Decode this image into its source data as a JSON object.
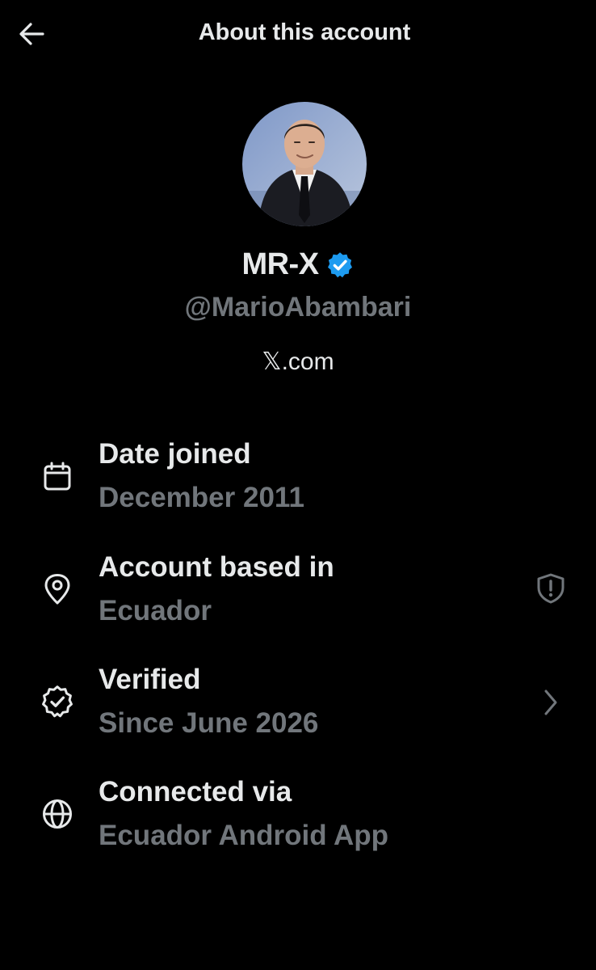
{
  "header": {
    "title": "About this account",
    "back_icon": "arrow-left-icon"
  },
  "profile": {
    "display_name": "MR-X",
    "verified_badge_color": "#1d9bf0",
    "handle": "@MarioAbambari",
    "website": "𝕏.com"
  },
  "rows": [
    {
      "icon": "calendar-icon",
      "label": "Date joined",
      "value": "December 2011",
      "trailing_icon": ""
    },
    {
      "icon": "location-pin-icon",
      "label": "Account based in",
      "value": "Ecuador",
      "trailing_icon": "shield-alert-icon"
    },
    {
      "icon": "verified-seal-icon",
      "label": "Verified",
      "value": "Since June 2026",
      "trailing_icon": "chevron-right-icon"
    },
    {
      "icon": "globe-icon",
      "label": "Connected via",
      "value": "Ecuador Android App",
      "trailing_icon": ""
    }
  ],
  "colors": {
    "background": "#000000",
    "primary_text": "#e7e9ea",
    "secondary_text": "#71767b",
    "accent": "#1d9bf0"
  }
}
